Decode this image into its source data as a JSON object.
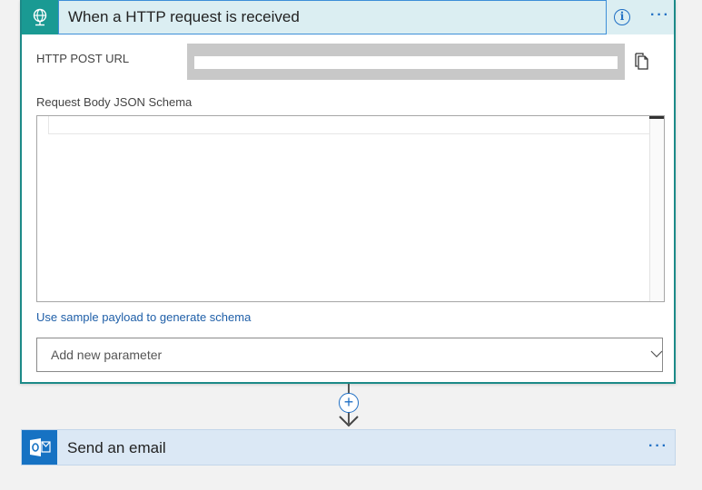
{
  "trigger": {
    "title": "When a HTTP request is received",
    "icon": "http-globe-icon",
    "info_symbol": "i",
    "more_symbol": "···",
    "http_post_url_label": "HTTP POST URL",
    "http_post_url_value": "",
    "schema_label": "Request Body JSON Schema",
    "schema_value": "",
    "sample_payload_link": "Use sample payload to generate schema",
    "add_parameter_placeholder": "Add new parameter"
  },
  "connector": {
    "plus_symbol": "+"
  },
  "action": {
    "title": "Send an email",
    "icon": "outlook-icon",
    "more_symbol": "···"
  },
  "colors": {
    "trigger_accent": "#1a9a93",
    "trigger_header_bg": "#dbeef2",
    "action_accent": "#1672c3",
    "action_header_bg": "#dbe8f5",
    "link": "#1f5fa8"
  }
}
